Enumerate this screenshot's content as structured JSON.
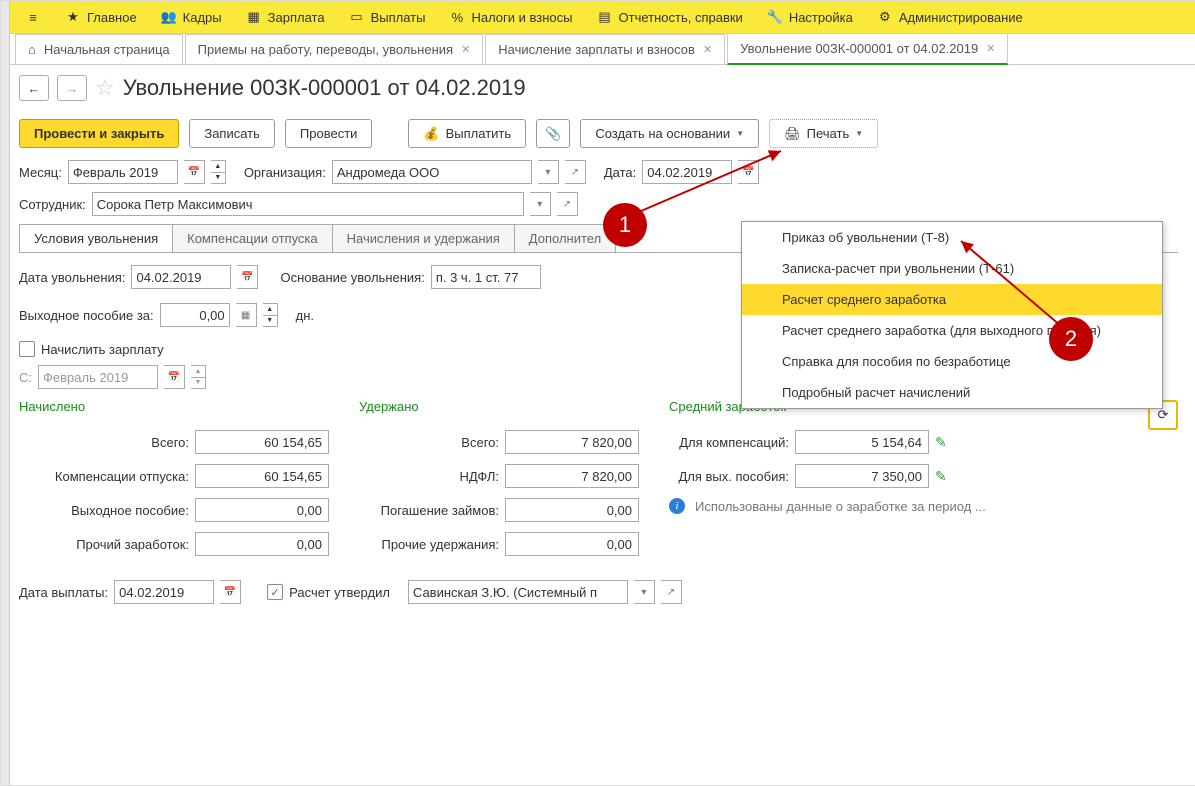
{
  "topmenu": {
    "main": "Главное",
    "hr": "Кадры",
    "salary": "Зарплата",
    "payments": "Выплаты",
    "taxes": "Налоги и взносы",
    "reports": "Отчетность, справки",
    "settings": "Настройка",
    "admin": "Администрирование"
  },
  "tabs": {
    "home": "Начальная страница",
    "hires": "Приемы на работу, переводы, увольнения",
    "calc": "Начисление зарплаты и взносов",
    "active": "Увольнение 00ЗК-000001 от 04.02.2019"
  },
  "page": {
    "title": "Увольнение 00ЗК-000001 от 04.02.2019"
  },
  "toolbar": {
    "postclose": "Провести и закрыть",
    "write": "Записать",
    "post": "Провести",
    "pay": "Выплатить",
    "createbase": "Создать на основании",
    "print": "Печать"
  },
  "fields": {
    "month_lbl": "Месяц:",
    "month": "Февраль 2019",
    "org_lbl": "Организация:",
    "org": "Андромеда ООО",
    "date_lbl": "Дата:",
    "date": "04.02.2019",
    "emp_lbl": "Сотрудник:",
    "emp": "Сорока Петр Максимович"
  },
  "itabs": {
    "t1": "Условия увольнения",
    "t2": "Компенсации отпуска",
    "t3": "Начисления и удержания",
    "t4": "Дополнител"
  },
  "dismiss": {
    "date_lbl": "Дата увольнения:",
    "date": "04.02.2019",
    "reason_lbl": "Основание увольнения:",
    "reason": "п. 3 ч. 1 ст. 77",
    "sev_lbl": "Выходное пособие за:",
    "sev_val": "0,00",
    "sev_unit": "дн.",
    "accrue": "Начислить зарплату",
    "since_lbl": "С:",
    "since": "Февраль 2019"
  },
  "cols": {
    "accrued": "Начислено",
    "withheld": "Удержано",
    "average": "Средний заработок"
  },
  "accrued": {
    "total_lbl": "Всего:",
    "total": "60 154,65",
    "vac_lbl": "Компенсации отпуска:",
    "vac": "60 154,65",
    "sev_lbl": "Выходное пособие:",
    "sev": "0,00",
    "oth_lbl": "Прочий заработок:",
    "oth": "0,00"
  },
  "withheld": {
    "total_lbl": "Всего:",
    "total": "7 820,00",
    "ndfl_lbl": "НДФЛ:",
    "ndfl": "7 820,00",
    "loan_lbl": "Погашение займов:",
    "loan": "0,00",
    "oth_lbl": "Прочие удержания:",
    "oth": "0,00"
  },
  "avg": {
    "comp_lbl": "Для компенсаций:",
    "comp": "5 154,64",
    "sev_lbl": "Для вых. пособия:",
    "sev": "7 350,00",
    "note": "Использованы данные о заработке за период ..."
  },
  "footer": {
    "paydate_lbl": "Дата выплаты:",
    "paydate": "04.02.2019",
    "approved": "Расчет утвердил",
    "approver": "Савинская З.Ю. (Системный п"
  },
  "printmenu": {
    "i1": "Приказ об увольнении (Т-8)",
    "i2": "Записка-расчет при увольнении (Т-61)",
    "i3": "Расчет среднего заработка",
    "i4": "Расчет среднего заработка (для выходного пособия)",
    "i5": "Справка для пособия по безработице",
    "i6": "Подробный расчет начислений"
  },
  "callouts": {
    "c1": "1",
    "c2": "2"
  }
}
